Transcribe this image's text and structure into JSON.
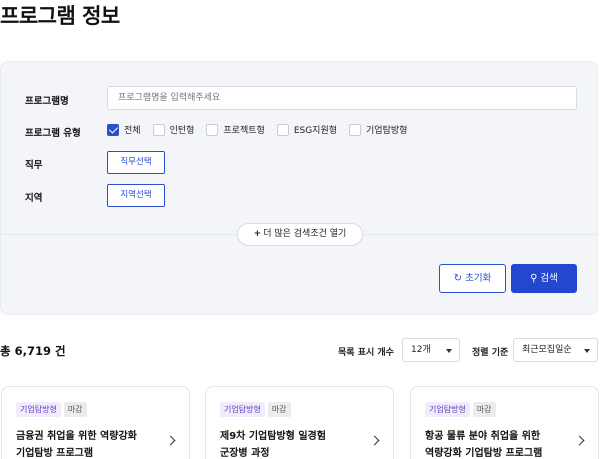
{
  "page": {
    "title": "프로그램 정보"
  },
  "filters": {
    "name_label": "프로그램명",
    "name_placeholder": "프로그램명을 입력해주세요",
    "type_label": "프로그램 유형",
    "types": [
      {
        "label": "전체",
        "checked": true
      },
      {
        "label": "인턴형",
        "checked": false
      },
      {
        "label": "프로젝트형",
        "checked": false
      },
      {
        "label": "ESG지원형",
        "checked": false
      },
      {
        "label": "기업탐방형",
        "checked": false
      }
    ],
    "job_label": "직무",
    "job_button": "직무선택",
    "region_label": "지역",
    "region_button": "지역선택",
    "more_button": "더 많은 검색조건 열기",
    "reset_button": "초기화",
    "search_button": "검색"
  },
  "results": {
    "total_text": "총 6,719 건",
    "page_size_label": "목록 표시 개수",
    "page_size_value": "12개",
    "sort_label": "정렬 기준",
    "sort_value": "최근모집일순"
  },
  "cards": [
    {
      "type": "기업탐방형",
      "status": "마감",
      "title_line1": "금융권 취업을 위한 역량강화",
      "title_line2": "기업탐방 프로그램"
    },
    {
      "type": "기업탐방형",
      "status": "마감",
      "title_line1": "제9차 기업탐방형 일경험",
      "title_line2": "군장병 과정"
    },
    {
      "type": "기업탐방형",
      "status": "마감",
      "title_line1": "항공 물류 분야 취업을 위한",
      "title_line2": "역량강화 기업탐방 프로그램"
    }
  ]
}
